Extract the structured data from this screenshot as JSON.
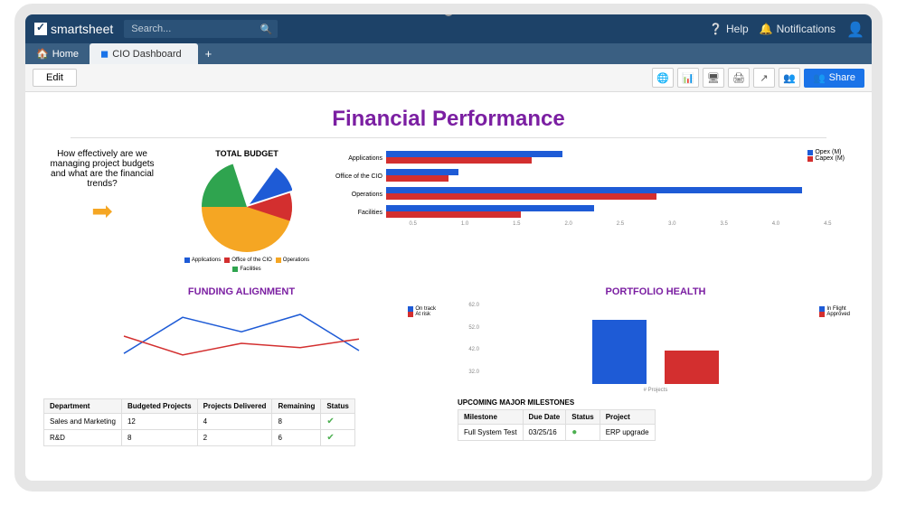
{
  "brand": "smartsheet",
  "search": {
    "placeholder": "Search..."
  },
  "topnav": {
    "help": "Help",
    "notifications": "Notifications"
  },
  "tabs": {
    "home": "Home",
    "active": "CIO Dashboard"
  },
  "toolbar": {
    "edit": "Edit",
    "share": "Share"
  },
  "page": {
    "title": "Financial Performance"
  },
  "question": "How effectively are we managing project budgets and what are the financial trends?",
  "budget": {
    "title": "TOTAL BUDGET"
  },
  "colors": {
    "blue": "#1e5bd6",
    "red": "#d32f2f",
    "green": "#2fa44f",
    "orange": "#f5a623",
    "purple": "#7b1fa2"
  },
  "funding": {
    "title": "FUNDING ALIGNMENT"
  },
  "portfolio": {
    "title": "PORTFOLIO HEALTH"
  },
  "chart_data": [
    {
      "id": "total_budget_pie",
      "type": "pie",
      "title": "TOTAL BUDGET",
      "series": [
        {
          "name": "Applications",
          "value": 10,
          "color": "#1e5bd6"
        },
        {
          "name": "Office of the CIO",
          "value": 10,
          "color": "#d32f2f"
        },
        {
          "name": "Operations",
          "value": 50,
          "color": "#f5a623"
        },
        {
          "name": "Facilities",
          "value": 30,
          "color": "#2fa44f"
        }
      ]
    },
    {
      "id": "opex_capex_bars",
      "type": "bar",
      "orientation": "horizontal",
      "xlabel": "",
      "xlim": [
        0,
        4.5
      ],
      "xticks": [
        0.5,
        1.0,
        1.5,
        2.0,
        2.5,
        3.0,
        3.5,
        4.0,
        4.5
      ],
      "categories": [
        "Applications",
        "Office of the CIO",
        "Operations",
        "Facilities"
      ],
      "series": [
        {
          "name": "Opex (M)",
          "color": "#1e5bd6",
          "values": [
            1.7,
            0.7,
            4.0,
            2.0
          ]
        },
        {
          "name": "Capex (M)",
          "color": "#d32f2f",
          "values": [
            1.4,
            0.6,
            2.6,
            1.3
          ]
        }
      ]
    },
    {
      "id": "funding_alignment_line",
      "type": "line",
      "title": "FUNDING ALIGNMENT",
      "x": [
        1,
        2,
        3,
        4,
        5
      ],
      "series": [
        {
          "name": "On track",
          "color": "#1e5bd6",
          "values": [
            18,
            43,
            33,
            45,
            20
          ]
        },
        {
          "name": "At risk",
          "color": "#d32f2f",
          "values": [
            30,
            17,
            25,
            22,
            28
          ]
        }
      ],
      "ylim": [
        0,
        50
      ],
      "legend_position": "right"
    },
    {
      "id": "portfolio_health_bar",
      "type": "bar",
      "title": "PORTFOLIO HEALTH",
      "categories": [
        "In Flight",
        "Approved"
      ],
      "series": [
        {
          "name": "In Flight",
          "color": "#1e5bd6",
          "values": [
            62,
            0
          ]
        },
        {
          "name": "Approved",
          "color": "#d32f2f",
          "values": [
            0,
            32
          ]
        }
      ],
      "xlabel": "# Projects",
      "ylim": [
        0,
        70
      ],
      "yticks": [
        32,
        42,
        52,
        62
      ]
    }
  ],
  "dept_table": {
    "headers": [
      "Department",
      "Budgeted Projects",
      "Projects Delivered",
      "Remaining",
      "Status"
    ],
    "rows": [
      {
        "dept": "Sales and Marketing",
        "budgeted": "12",
        "delivered": "4",
        "remaining": "8",
        "status": "ok"
      },
      {
        "dept": "R&D",
        "budgeted": "8",
        "delivered": "2",
        "remaining": "6",
        "status": "ok"
      }
    ]
  },
  "milestones": {
    "title": "UPCOMING MAJOR MILESTONES",
    "headers": [
      "Milestone",
      "Due Date",
      "Status",
      "Project"
    ],
    "rows": [
      {
        "milestone": "Full System Test",
        "due": "03/25/16",
        "status": "ok",
        "project": "ERP upgrade"
      }
    ]
  }
}
